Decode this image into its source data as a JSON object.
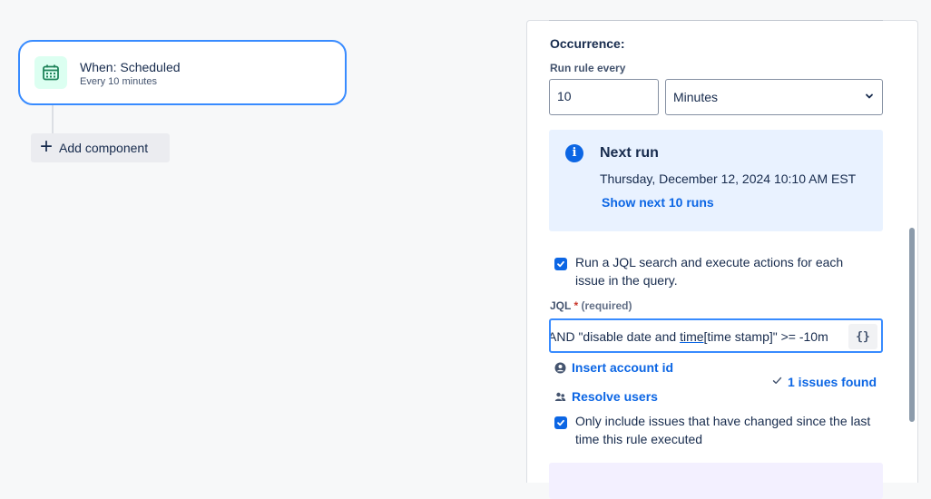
{
  "trigger": {
    "title": "When: Scheduled",
    "subtitle": "Every 10 minutes",
    "icon": "calendar-icon"
  },
  "canvas": {
    "add_component_label": "Add component"
  },
  "panel": {
    "occurrence_label": "Occurrence:",
    "run_rule_every_label": "Run rule every",
    "interval_value": "10",
    "interval_unit": "Minutes",
    "next_run": {
      "title": "Next run",
      "date": "Thursday, December 12, 2024 10:10 AM EST",
      "show_next_label": "Show next 10 runs"
    },
    "jql_search_checkbox_label": "Run a JQL search and execute actions for each issue in the query.",
    "jql_label": "JQL",
    "jql_required_text": "(required)",
    "jql_value_before": "AND \"disable date and ",
    "jql_value_underlined": "time",
    "jql_value_after": "[time stamp]\" >= -10m",
    "jql_braces_label": "{}",
    "insert_account_id_label": "Insert account id",
    "resolve_users_label": "Resolve users",
    "issues_found_label": "1 issues found",
    "only_include_checkbox_label": "Only include issues that have changed since the last time this rule executed"
  },
  "colors": {
    "accent": "#0c66e4",
    "info_bg": "#e9f2ff",
    "trigger_icon_bg": "#dcfff1",
    "trigger_icon": "#1f845a"
  }
}
